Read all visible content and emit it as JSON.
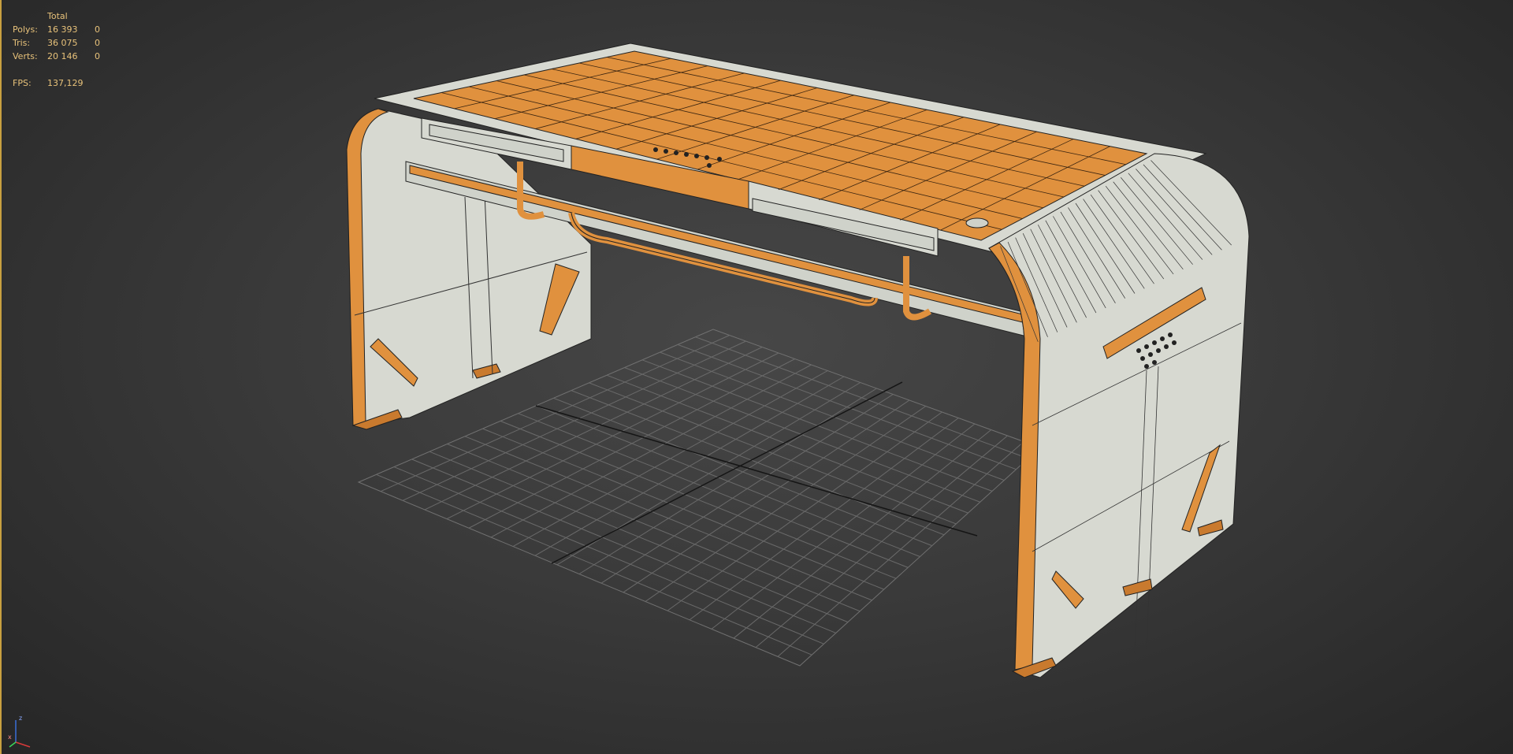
{
  "viewport": {
    "stats": {
      "header": "Total",
      "rows": [
        {
          "label": "Polys:",
          "total": "16 393",
          "selected": "0"
        },
        {
          "label": "Tris:",
          "total": "36 075",
          "selected": "0"
        },
        {
          "label": "Verts:",
          "total": "20 146",
          "selected": "0"
        }
      ],
      "fps_label": "FPS:",
      "fps_value": "137,129"
    },
    "gizmo": {
      "z": "z",
      "x": "x"
    },
    "colors": {
      "accent_orange": "#e0913e",
      "panel_white": "#d9dbd3",
      "wire": "#1a1a1a",
      "grid": "#7a7a7a",
      "stats_text": "#e8c27a",
      "border": "#c8a040"
    }
  }
}
